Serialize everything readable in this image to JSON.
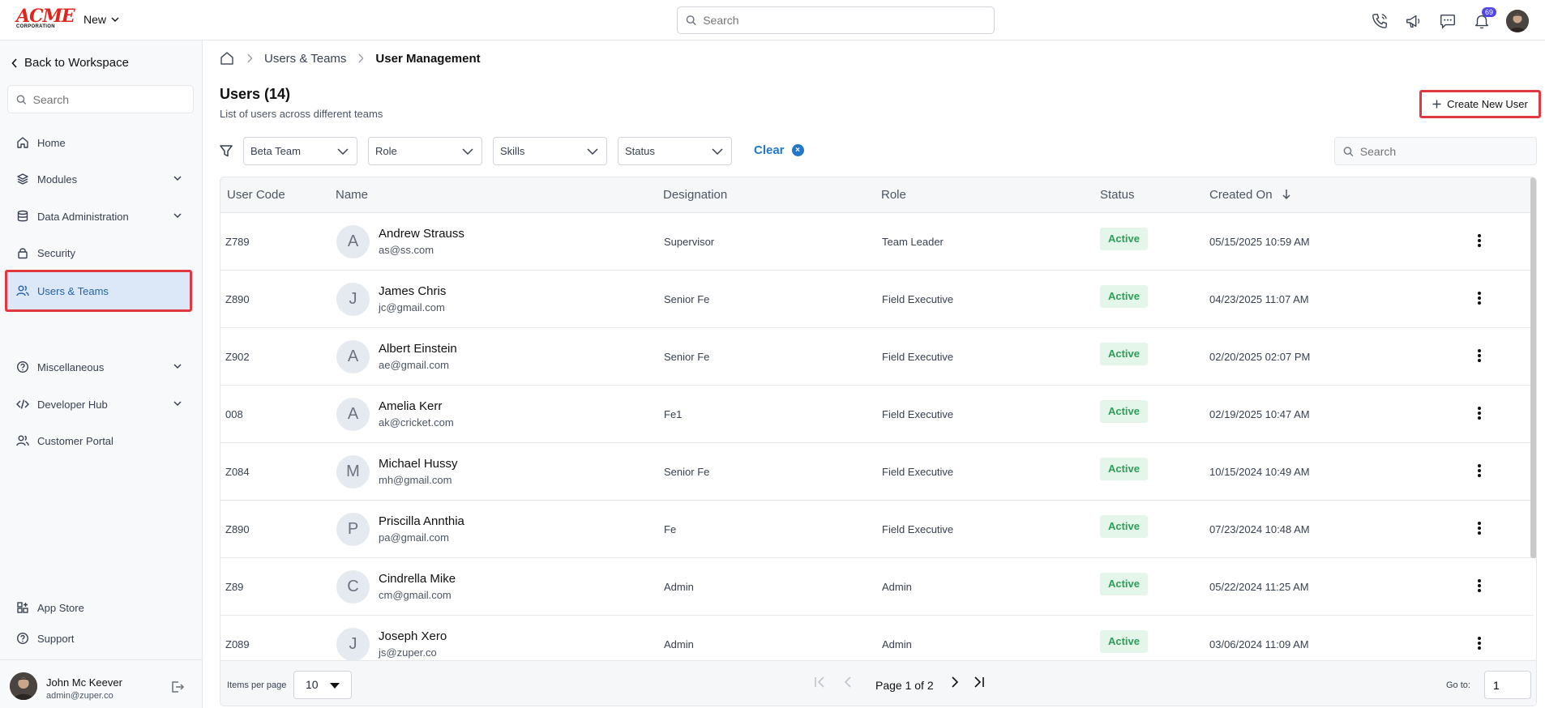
{
  "brand": {
    "logo_text": "ACME",
    "logo_sub": "CORPORATION"
  },
  "topbar": {
    "new_label": "New",
    "search_placeholder": "Search",
    "notification_count": "69"
  },
  "sidebar": {
    "back_label": "Back to Workspace",
    "search_placeholder": "Search",
    "items": [
      {
        "label": "Home",
        "icon": "home-icon"
      },
      {
        "label": "Modules",
        "icon": "layers-icon"
      },
      {
        "label": "Data Administration",
        "icon": "database-icon"
      },
      {
        "label": "Security",
        "icon": "lock-icon"
      },
      {
        "label": "Users & Teams",
        "icon": "users-icon"
      },
      {
        "label": "Miscellaneous",
        "icon": "help-circle-icon"
      },
      {
        "label": "Developer Hub",
        "icon": "code-icon"
      },
      {
        "label": "Customer Portal",
        "icon": "users-icon"
      }
    ],
    "bottom_items": [
      {
        "label": "App Store",
        "icon": "apps-icon"
      },
      {
        "label": "Support",
        "icon": "help-circle-icon"
      }
    ],
    "user": {
      "name": "John Mc Keever",
      "email": "admin@zuper.co"
    }
  },
  "breadcrumb": {
    "level1": "Users & Teams",
    "current": "User Management"
  },
  "page": {
    "title": "Users (14)",
    "subtitle": "List of users across different teams",
    "create_label": "Create New User"
  },
  "filters": {
    "team": "Beta Team",
    "role": "Role",
    "skills": "Skills",
    "status": "Status",
    "clear_label": "Clear",
    "search_placeholder": "Search"
  },
  "table": {
    "columns": [
      "User Code",
      "Name",
      "Designation",
      "Role",
      "Status",
      "Created On"
    ],
    "rows": [
      {
        "code": "Z789",
        "initial": "A",
        "name": "Andrew Strauss",
        "email": "as@ss.com",
        "designation": "Supervisor",
        "role": "Team Leader",
        "status": "Active",
        "created": "05/15/2025 10:59 AM"
      },
      {
        "code": "Z890",
        "initial": "J",
        "name": "James Chris",
        "email": "jc@gmail.com",
        "designation": "Senior Fe",
        "role": "Field Executive",
        "status": "Active",
        "created": "04/23/2025 11:07 AM"
      },
      {
        "code": "Z902",
        "initial": "A",
        "name": "Albert Einstein",
        "email": "ae@gmail.com",
        "designation": "Senior Fe",
        "role": "Field Executive",
        "status": "Active",
        "created": "02/20/2025 02:07 PM"
      },
      {
        "code": "008",
        "initial": "A",
        "name": "Amelia Kerr",
        "email": "ak@cricket.com",
        "designation": "Fe1",
        "role": "Field Executive",
        "status": "Active",
        "created": "02/19/2025 10:47 AM"
      },
      {
        "code": "Z084",
        "initial": "M",
        "name": "Michael Hussy",
        "email": "mh@gmail.com",
        "designation": "Senior Fe",
        "role": "Field Executive",
        "status": "Active",
        "created": "10/15/2024 10:49 AM"
      },
      {
        "code": "Z890",
        "initial": "P",
        "name": "Priscilla Annthia",
        "email": "pa@gmail.com",
        "designation": "Fe",
        "role": "Field Executive",
        "status": "Active",
        "created": "07/23/2024 10:48 AM"
      },
      {
        "code": "Z89",
        "initial": "C",
        "name": "Cindrella Mike",
        "email": "cm@gmail.com",
        "designation": "Admin",
        "role": "Admin",
        "status": "Active",
        "created": "05/22/2024 11:25 AM"
      },
      {
        "code": "Z089",
        "initial": "J",
        "name": "Joseph Xero",
        "email": "js@zuper.co",
        "designation": "Admin",
        "role": "Admin",
        "status": "Active",
        "created": "03/06/2024 11:09 AM"
      }
    ]
  },
  "pagination": {
    "items_per_page_label": "Items per page",
    "items_per_page": "10",
    "page_info": "Page 1 of 2",
    "goto_label": "Go to:",
    "goto_value": "1"
  },
  "colors": {
    "accent": "#2277c9",
    "highlight_border": "#e0383e",
    "active_nav_bg": "#dce8f8",
    "status_bg": "#e4f5ea",
    "status_text": "#2f9d58"
  }
}
